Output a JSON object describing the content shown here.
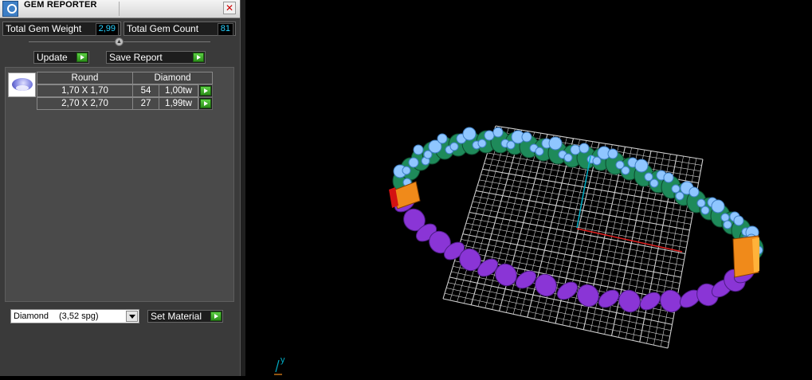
{
  "panel": {
    "title": "GEM REPORTER",
    "close_glyph": "✕",
    "icons": {
      "app": "gem-reporter-app-icon",
      "close": "close-icon",
      "play": "play-arrow-icon",
      "dropdown": "chevron-down-icon",
      "gem": "round-diamond-icon"
    },
    "total_weight_label": "Total Gem Weight",
    "total_weight_value": "2,99",
    "total_count_label": "Total Gem Count",
    "total_count_value": "81",
    "update_label": "Update",
    "save_report_label": "Save Report",
    "table": {
      "headers": [
        "Round",
        "Diamond"
      ],
      "rows": [
        {
          "size": "1,70 X 1,70",
          "count": "54",
          "weight": "1,00tw"
        },
        {
          "size": "2,70 X 2,70",
          "count": "27",
          "weight": "1,99tw"
        }
      ]
    },
    "material": {
      "name": "Diamond",
      "density": "(3,52 spg)"
    },
    "set_material_label": "Set Material"
  },
  "viewport": {
    "axis_label": "y",
    "colors": {
      "background": "#000000",
      "grid": "#cfcfcf",
      "gem_metal": "#1e8a5a",
      "gems": "#8fc6ff",
      "band": "#8a35d6",
      "clasp": "#f08a1a",
      "axis_y": "#00b0c8",
      "axis_x": "#e02020"
    }
  }
}
